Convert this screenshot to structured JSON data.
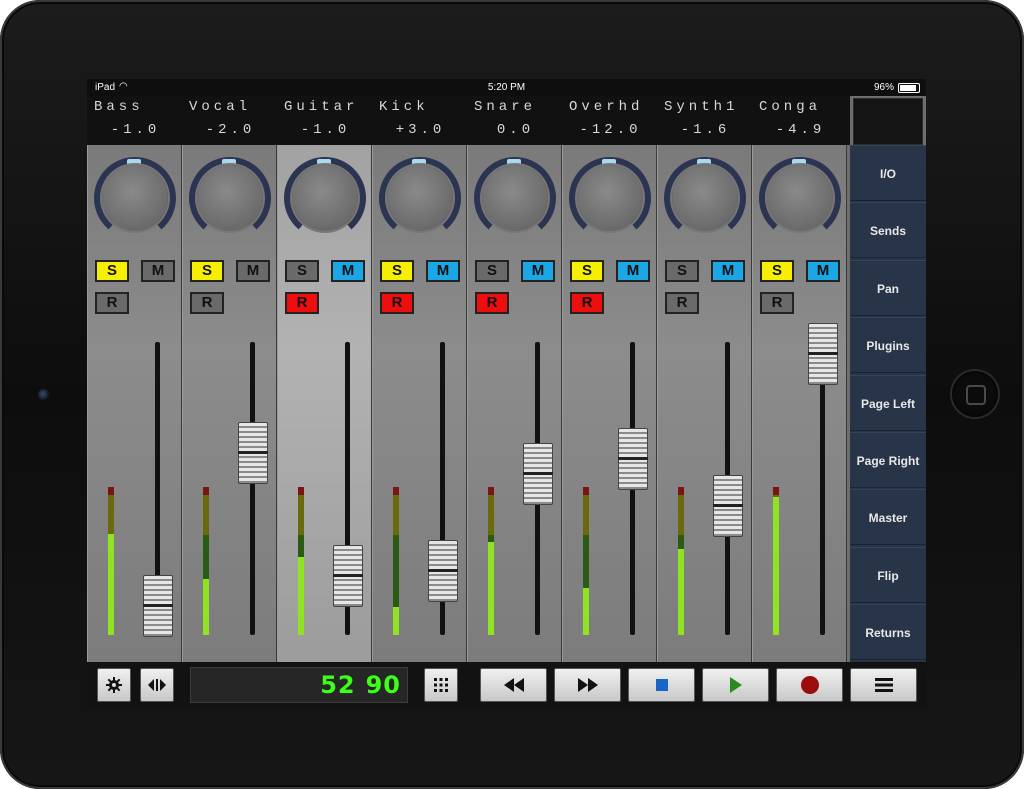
{
  "status_bar": {
    "carrier": "iPad",
    "time": "5:20 PM",
    "battery": "96%"
  },
  "channels": [
    {
      "name": "Bass",
      "value": "-1.0",
      "solo": true,
      "mute": false,
      "record": false,
      "selected": false,
      "meter_level": 0.68,
      "fader": 0.1
    },
    {
      "name": "Vocal",
      "value": "-2.0",
      "solo": true,
      "mute": false,
      "record": false,
      "selected": false,
      "meter_level": 0.38,
      "fader": 0.62
    },
    {
      "name": "Guitar",
      "value": "-1.0",
      "solo": false,
      "mute": true,
      "record": true,
      "selected": true,
      "meter_level": 0.53,
      "fader": 0.2
    },
    {
      "name": "Kick",
      "value": "+3.0",
      "solo": true,
      "mute": true,
      "record": true,
      "selected": false,
      "meter_level": 0.19,
      "fader": 0.22
    },
    {
      "name": "Snare",
      "value": "0.0",
      "solo": false,
      "mute": true,
      "record": true,
      "selected": false,
      "meter_level": 0.63,
      "fader": 0.55
    },
    {
      "name": "Overhd",
      "value": "-12.0",
      "solo": true,
      "mute": true,
      "record": true,
      "selected": false,
      "meter_level": 0.32,
      "fader": 0.6
    },
    {
      "name": "Synth1",
      "value": "-1.6",
      "solo": false,
      "mute": true,
      "record": false,
      "selected": false,
      "meter_level": 0.58,
      "fader": 0.44
    },
    {
      "name": "Conga",
      "value": "-4.9",
      "solo": true,
      "mute": true,
      "record": false,
      "selected": false,
      "meter_level": 0.93,
      "fader": 0.96
    }
  ],
  "button_labels": {
    "solo": "S",
    "mute": "M",
    "record": "R"
  },
  "sidebar": {
    "items": [
      "I/O",
      "Sends",
      "Pan",
      "Plugins",
      "Page Left",
      "Page Right",
      "Master",
      "Flip",
      "Returns"
    ]
  },
  "toolbar": {
    "counter_a": "52",
    "counter_b": "90",
    "icons": [
      "gear-icon",
      "arrows-left-right-icon",
      "grid-icon",
      "rewind-icon",
      "fast-forward-icon",
      "stop-icon",
      "play-icon",
      "record-icon",
      "menu-icon"
    ]
  },
  "colors": {
    "solo_on": "#f6f000",
    "mute_on": "#1ba6e6",
    "record_on": "#ee0e0e",
    "sidebar_bg": "#283447",
    "counter_text": "#3cff1a"
  }
}
